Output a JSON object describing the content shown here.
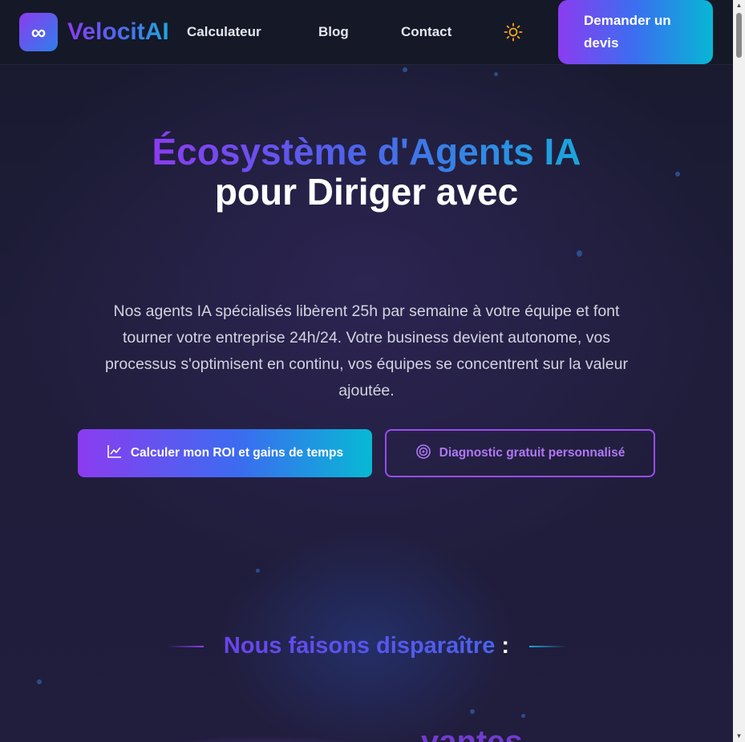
{
  "header": {
    "logo_symbol": "∞",
    "brand": "VelocitAI",
    "nav": [
      "Calculateur",
      "Blog",
      "Contact"
    ],
    "theme_icon": "sun-icon",
    "cta": "Demander un devis"
  },
  "hero": {
    "title_gradient": "Écosystème d'Agents IA",
    "title_white": "pour Diriger avec",
    "description": "Nos agents IA spécialisés libèrent 25h par semaine à votre équipe et font tourner votre entreprise 24h/24. Votre business devient autonome, vos processus s'optimisent en continu, vos équipes se concentrent sur la valeur ajoutée.",
    "primary_button": "Calculer mon ROI et gains de temps",
    "primary_icon": "line-chart-icon",
    "secondary_button": "Diagnostic gratuit personnalisé",
    "secondary_icon": "target-icon"
  },
  "section": {
    "title": "Nous faisons disparaître",
    "colon": ":",
    "teaser": "vantes"
  },
  "colors": {
    "accent_purple": "#8b3cf0",
    "accent_blue": "#3b6cf0",
    "accent_cyan": "#07b9d4",
    "background": "#1f1d3a"
  }
}
